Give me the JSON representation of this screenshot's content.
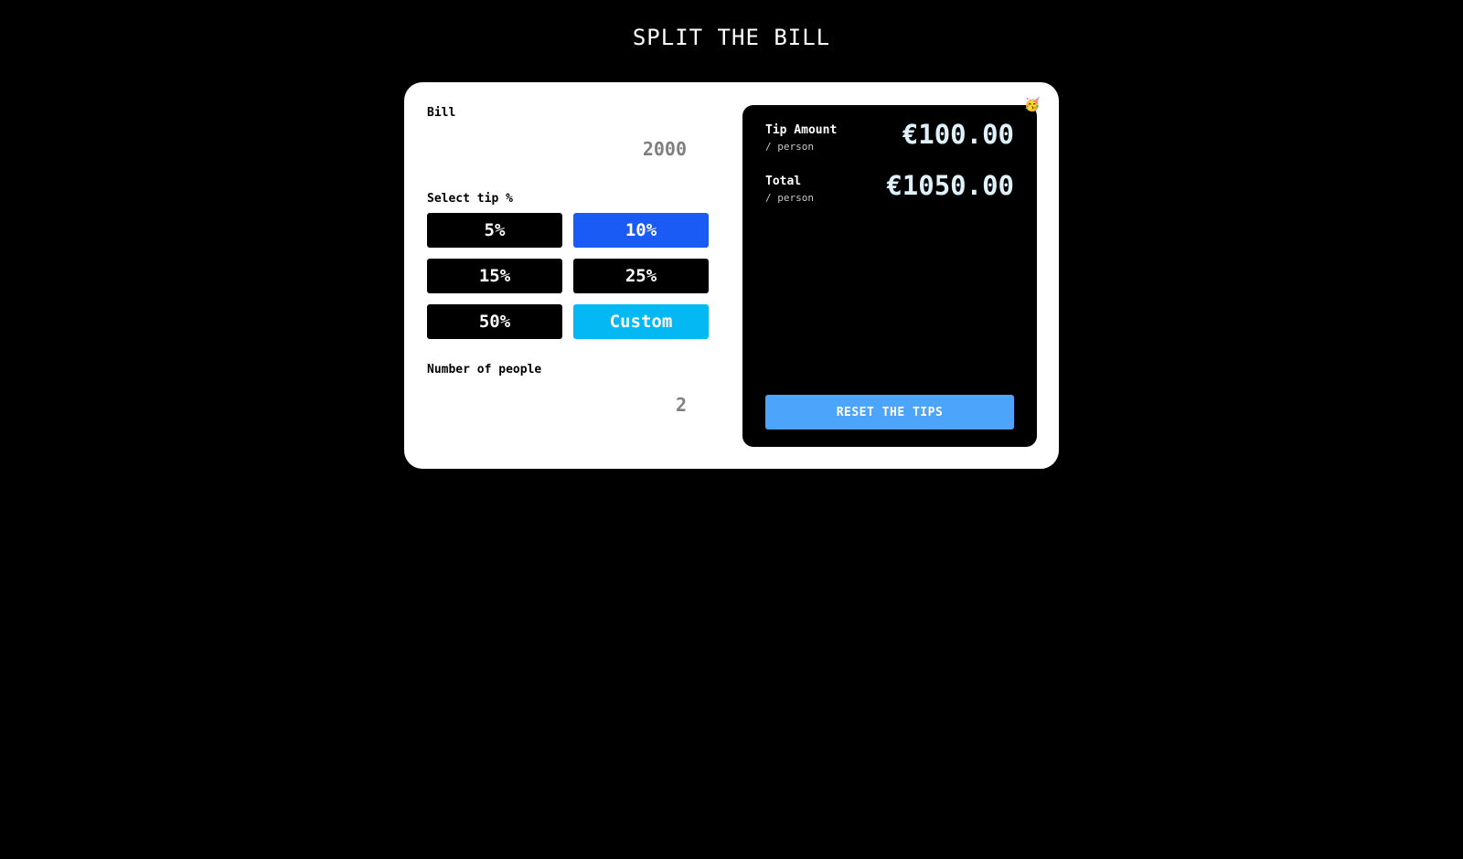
{
  "app": {
    "title": "SPLIT THE BILL"
  },
  "bill": {
    "label": "Bill",
    "value": "2000"
  },
  "tip": {
    "label": "Select tip %",
    "options": [
      {
        "label": "5%",
        "selected": false
      },
      {
        "label": "10%",
        "selected": true
      },
      {
        "label": "15%",
        "selected": false
      },
      {
        "label": "25%",
        "selected": false
      },
      {
        "label": "50%",
        "selected": false
      },
      {
        "label": "Custom",
        "selected": false
      }
    ]
  },
  "people": {
    "label": "Number of people",
    "value": "2"
  },
  "results": {
    "tip_amount": {
      "label": "Tip Amount",
      "sub": "/ person",
      "value": "€100.00"
    },
    "total": {
      "label": "Total",
      "sub": "/ person",
      "value": "€1050.00"
    },
    "reset_label": "RESET THE TIPS"
  },
  "icons": {
    "corner_emoji": "🥳"
  },
  "colors": {
    "selected_tip": "#1a5af5",
    "custom_tip": "#04b8f4",
    "reset_button": "#4da5fb",
    "result_value": "#dff1fb"
  }
}
